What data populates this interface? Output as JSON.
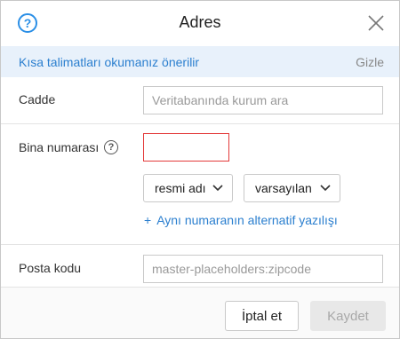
{
  "dialog": {
    "title": "Adres",
    "help_icon_glyph": "?",
    "close_icon": "close-icon"
  },
  "info_bar": {
    "text": "Kısa talimatları okumanız önerilir",
    "hide_label": "Gizle"
  },
  "fields": {
    "street": {
      "label": "Cadde",
      "value": "",
      "placeholder": "Veritabanında kurum ara"
    },
    "building": {
      "label": "Bina numarası",
      "value": "",
      "help_glyph": "?"
    },
    "name_type_select": {
      "selected": "resmi adı"
    },
    "variant_select": {
      "selected": "varsayılan"
    },
    "add_alternative": {
      "plus": "+",
      "label": "Aynı numaranın alternatif yazılışı"
    },
    "postcode": {
      "label": "Posta kodu",
      "value": "",
      "placeholder": "master-placeholders:zipcode"
    }
  },
  "footer": {
    "cancel_label": "İptal et",
    "save_label": "Kaydet"
  },
  "colors": {
    "accent": "#2b8fe6",
    "link": "#2b7fcf",
    "info_bg": "#e8f1fb",
    "error_border": "#e33a3a",
    "disabled_bg": "#e8e8e8"
  }
}
